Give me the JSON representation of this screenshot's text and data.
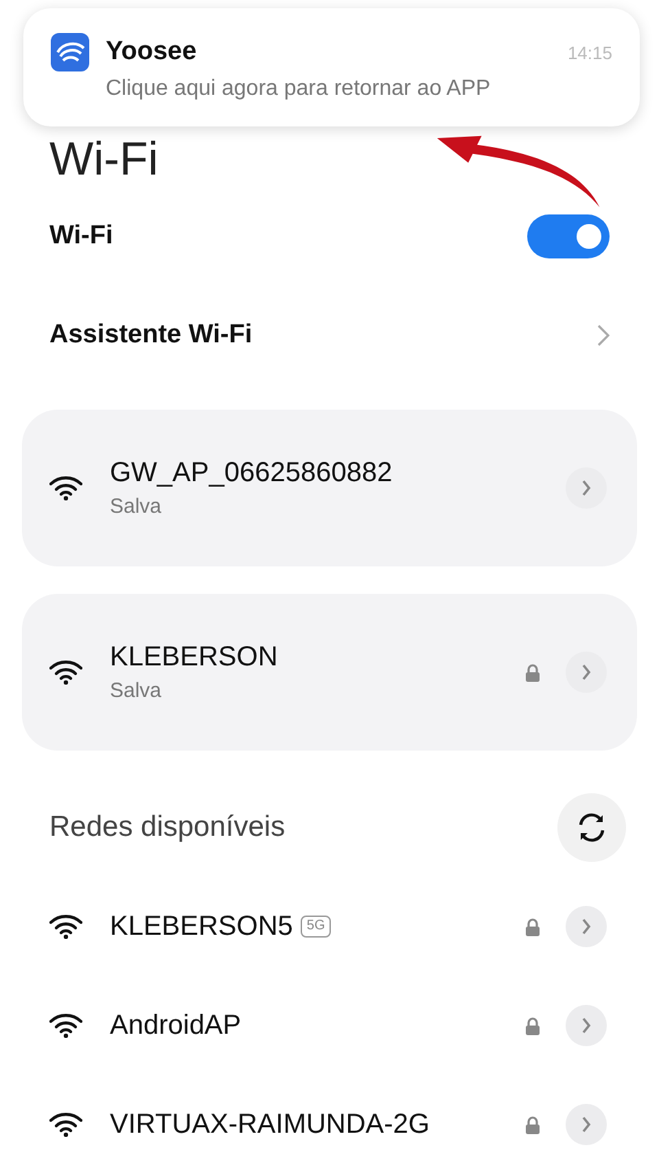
{
  "notification": {
    "app": "Yoosee",
    "time": "14:15",
    "message": "Clique aqui agora para retornar ao APP"
  },
  "page_title": "Wi-Fi",
  "wifi_toggle": {
    "label": "Wi-Fi",
    "on": true
  },
  "assistant": {
    "label": "Assistente Wi-Fi"
  },
  "saved_networks": [
    {
      "name": "GW_AP_06625860882",
      "status": "Salva",
      "locked": false
    },
    {
      "name": "KLEBERSON",
      "status": "Salva",
      "locked": true
    }
  ],
  "available": {
    "title": "Redes disponíveis",
    "networks": [
      {
        "name": "KLEBERSON5",
        "badge": "5G",
        "locked": true
      },
      {
        "name": "AndroidAP",
        "locked": true
      },
      {
        "name": "VIRTUAX-RAIMUNDA-2G",
        "locked": true
      }
    ]
  }
}
